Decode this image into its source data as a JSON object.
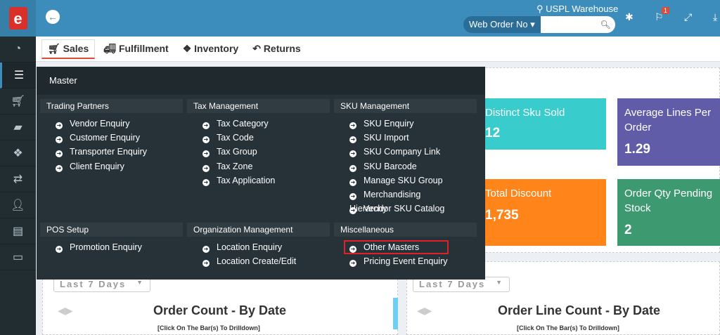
{
  "header": {
    "location": "USPL Warehouse",
    "search_type": "Web Order No",
    "search_value": "",
    "notification_count": "1"
  },
  "tabs": [
    "Sales",
    "Fulfillment",
    "Inventory",
    "Returns"
  ],
  "menu": {
    "title": "Master",
    "sections": [
      {
        "title": "Trading Partners",
        "items": [
          "Vendor Enquiry",
          "Customer Enquiry",
          "Transporter Enquiry",
          "Client Enquiry"
        ]
      },
      {
        "title": "Tax Management",
        "items": [
          "Tax Category",
          "Tax Code",
          "Tax Group",
          "Tax Zone",
          "Tax Application"
        ]
      },
      {
        "title": "SKU Management",
        "items": [
          "SKU Enquiry",
          "SKU Import",
          "SKU Company Link",
          "SKU Barcode",
          "Manage SKU Group",
          "Merchandising Hierarchy",
          "Vendor SKU Catalog"
        ]
      },
      {
        "title": "POS Setup",
        "items": [
          "Promotion Enquiry"
        ]
      },
      {
        "title": "Organization Management",
        "items": [
          "Location Enquiry",
          "Location Create/Edit"
        ]
      },
      {
        "title": "Miscellaneous",
        "items": [
          "Other Masters",
          "Pricing Event Enquiry"
        ]
      }
    ]
  },
  "cards": [
    {
      "label": "Distinct Sku Sold",
      "value": "12",
      "color": "#39cccc"
    },
    {
      "label": "Average Lines Per Order",
      "value": "1.29",
      "color": "#605ca8"
    },
    {
      "label": "Total Discount",
      "value": "1,735",
      "color": "#ff851b"
    },
    {
      "label": "Order Qty Pending Stock",
      "value": "2",
      "color": "#3d9970"
    }
  ],
  "charts": [
    {
      "range": "Last 7 Days",
      "title": "Order Count - By Date",
      "subtitle": "[Click On The Bar(s) To Drilldown]"
    },
    {
      "range": "Last 7 Days",
      "title": "Order Line Count - By Date",
      "subtitle": "[Click On The Bar(s) To Drilldown]"
    }
  ]
}
